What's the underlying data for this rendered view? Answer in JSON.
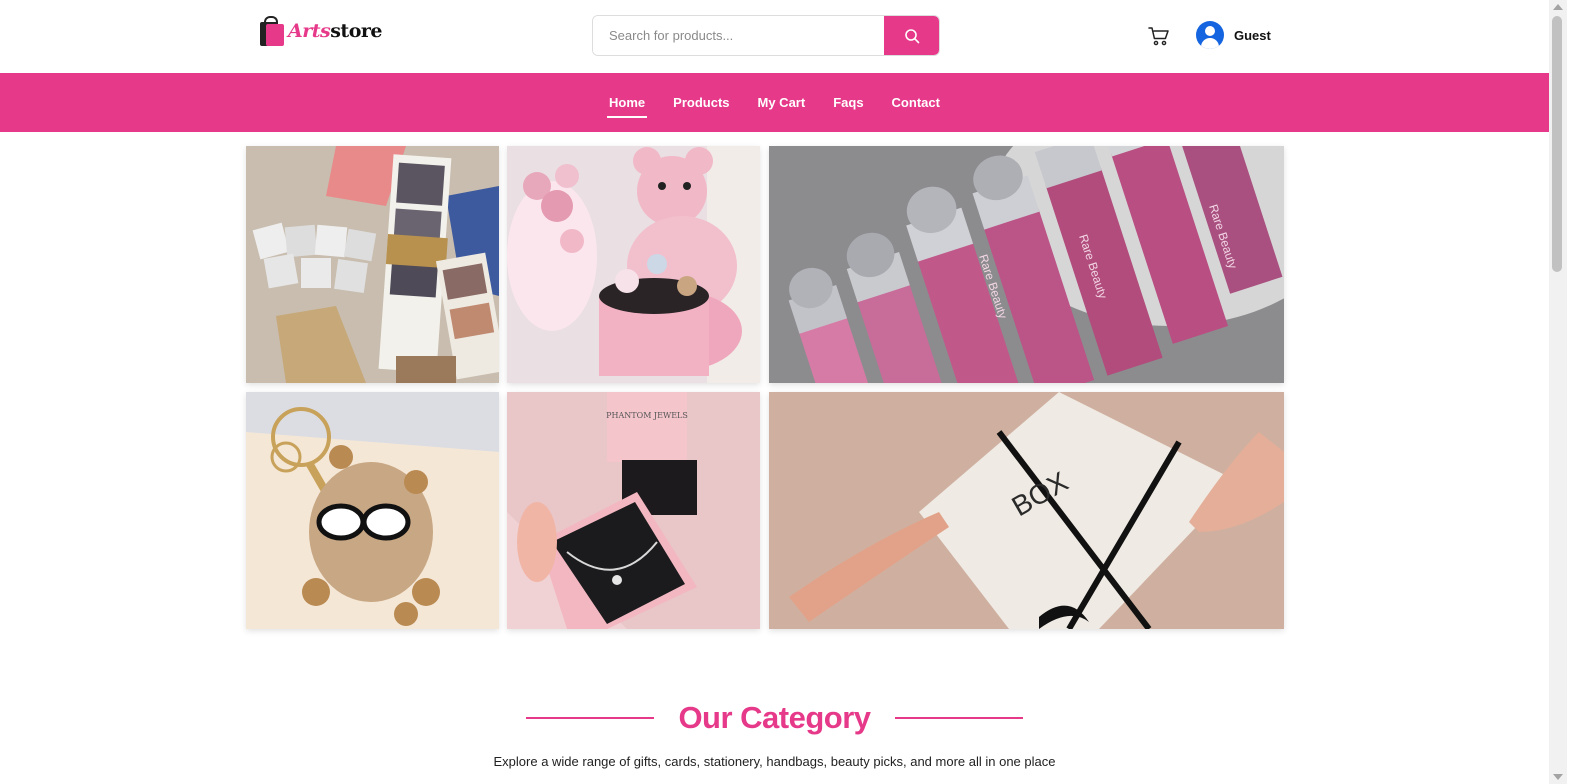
{
  "brand": {
    "name_part1": "Arts",
    "name_part2": "store"
  },
  "search": {
    "placeholder": "Search for products..."
  },
  "header": {
    "user_name": "Guest"
  },
  "nav": {
    "items": [
      "Home",
      "Products",
      "My Cart",
      "Faqs",
      "Contact"
    ],
    "active": "Home"
  },
  "gallery": {
    "tiles": [
      {
        "name": "photo-strips-bouquet-image",
        "text": ""
      },
      {
        "name": "pink-teddy-gift-box-image",
        "text": ""
      },
      {
        "name": "rare-beauty-lip-tint-image",
        "text": "Rare Beauty"
      },
      {
        "name": "fluffy-keychain-image",
        "text": ""
      },
      {
        "name": "phantom-jewels-necklace-image",
        "text": "PHANTOM JEWELS"
      },
      {
        "name": "gift-box-handover-image",
        "text": "BOX"
      }
    ]
  },
  "category": {
    "title": "Our Category",
    "subtitle": "Explore a wide range of gifts, cards, stationery, handbags, beauty picks, and more all in one place"
  },
  "colors": {
    "accent": "#e6398a",
    "user_icon": "#1565e0"
  }
}
